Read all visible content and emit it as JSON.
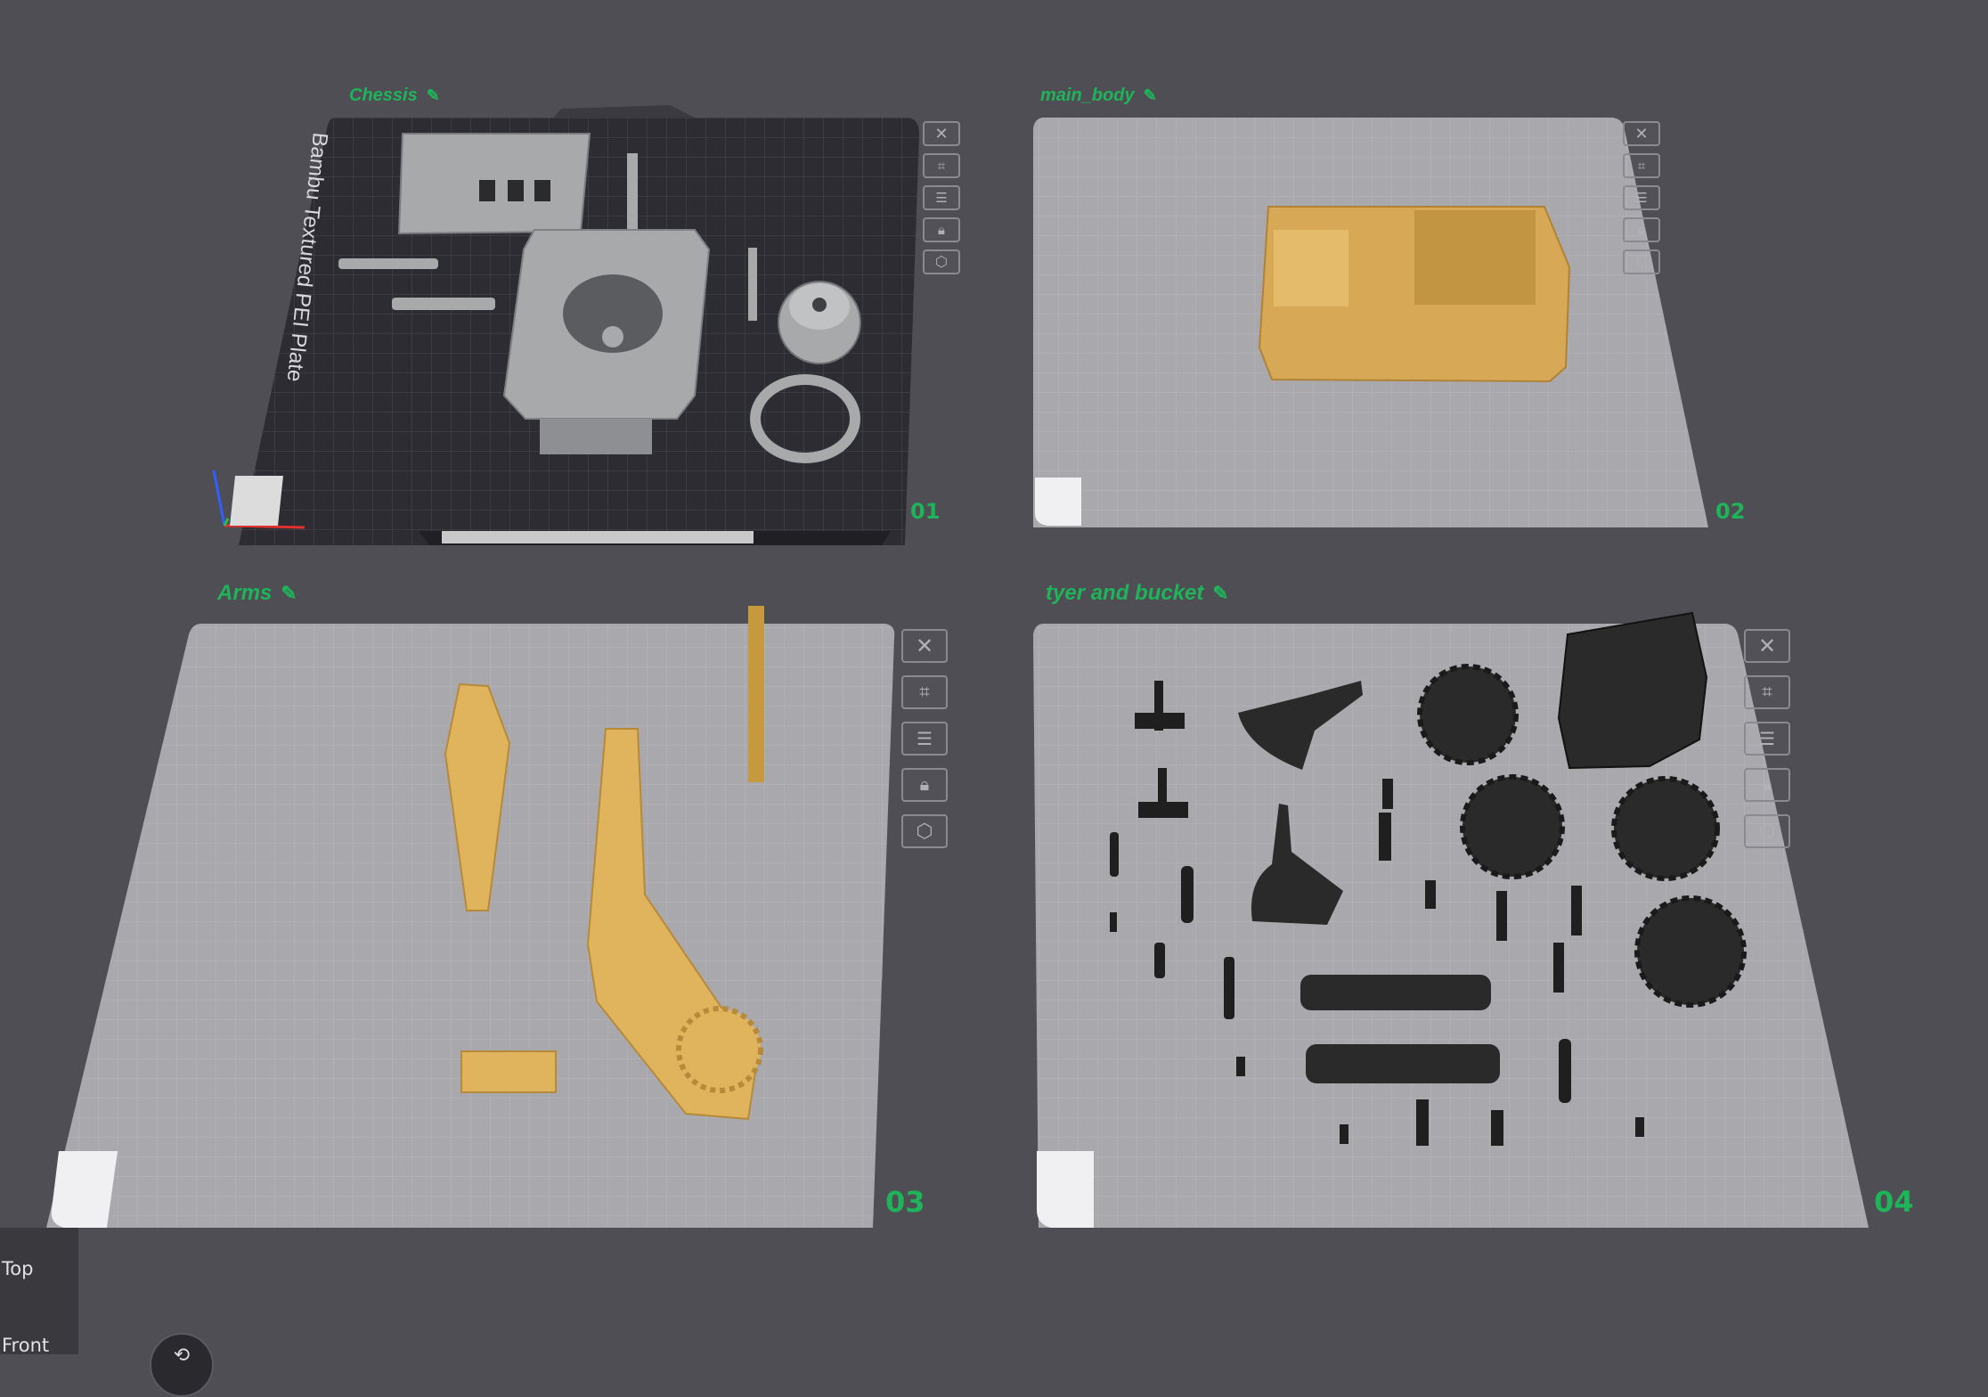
{
  "colors": {
    "background": "#4e4e54",
    "accent_green": "#1fb35a",
    "plate_light": "#a9a9ad",
    "plate_dark": "#2c2c32",
    "part_gold": "#e0b45c",
    "part_grey": "#a7a9ab",
    "part_black": "#2a2a2a"
  },
  "plates": [
    {
      "name": "Chessis",
      "number": "01",
      "bed_text": "Bambu Textured PEI Plate",
      "bed_style": "textured-pei-dark"
    },
    {
      "name": "main_body",
      "number": "02",
      "bed_style": "light-grid"
    },
    {
      "name": "Arms",
      "number": "03",
      "bed_style": "light-grid"
    },
    {
      "name": "tyer and bucket",
      "number": "04",
      "bed_style": "light-grid"
    }
  ],
  "plate_tools": [
    {
      "name": "delete-plate",
      "icon": "close-icon"
    },
    {
      "name": "auto-orient",
      "icon": "orient-icon"
    },
    {
      "name": "arrange",
      "icon": "arrange-icon"
    },
    {
      "name": "lock-plate",
      "icon": "lock-icon"
    },
    {
      "name": "plate-settings",
      "icon": "gear-icon"
    }
  ],
  "view_panel": {
    "items": [
      "Top",
      "Front"
    ]
  },
  "edit_icon": "pencil-icon"
}
